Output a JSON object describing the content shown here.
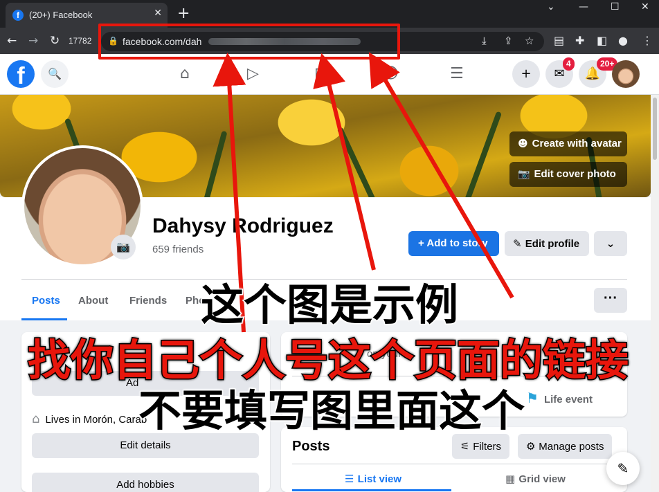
{
  "browser": {
    "tab_title": "(20+) Facebook",
    "tab_count": "17782",
    "url_visible": "facebook.com/dah"
  },
  "fb_nav": {
    "messenger_badge": "4",
    "notifications_badge": "20+"
  },
  "cover": {
    "create_avatar_label": "Create with avatar",
    "edit_cover_label": "Edit cover photo"
  },
  "profile": {
    "name": "Dahysy Rodriguez",
    "friends": "659 friends",
    "add_story_label": "Add to story",
    "edit_profile_label": "Edit profile",
    "tabs": [
      "Posts",
      "About",
      "Friends",
      "Pho"
    ]
  },
  "intro": {
    "add_bio_label": "Ad",
    "lives_in": "Lives in Morón, Carab",
    "edit_details_label": "Edit details",
    "add_hobbies_label": "Add hobbies"
  },
  "composer": {
    "fragment": "on your",
    "life_event_label": "Life event"
  },
  "posts_card": {
    "title": "Posts",
    "filters_label": "Filters",
    "manage_label": "Manage posts",
    "list_view_label": "List view",
    "grid_view_label": "Grid view"
  },
  "overlay": {
    "line1": "这个图是示例",
    "line2": "找你自己个人号这个页面的链接",
    "line3": "不要填写图里面这个"
  },
  "colors": {
    "fb_blue": "#1877f2",
    "annotation_red": "#e8160c"
  }
}
